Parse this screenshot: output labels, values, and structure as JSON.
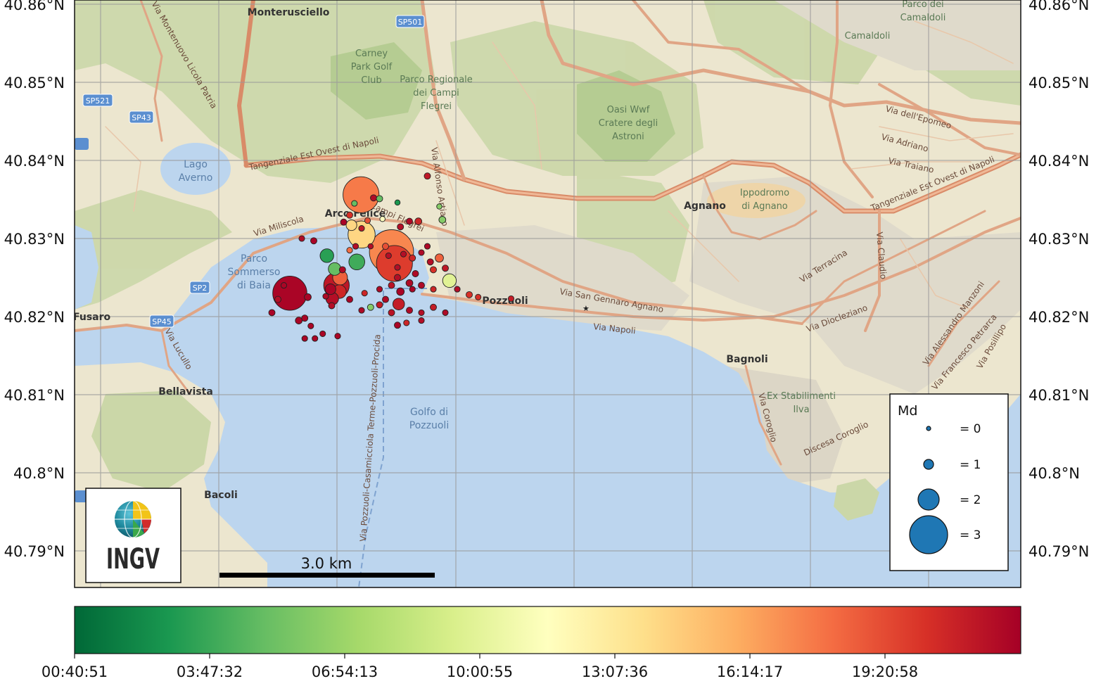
{
  "map": {
    "lat_labels": [
      "40.86°N",
      "40.85°N",
      "40.84°N",
      "40.83°N",
      "40.82°N",
      "40.81°N",
      "40.8°N",
      "40.79°N"
    ],
    "places": [
      {
        "id": "monterusciello",
        "text": "Monterusciello",
        "kind": "place"
      },
      {
        "id": "camaldoli",
        "text": "Camaldoli",
        "kind": "park"
      },
      {
        "id": "parco-camaldoli",
        "text": "Parco dei Camaldoli",
        "kind": "park"
      },
      {
        "id": "carney",
        "text": "Carney Park Golf Club",
        "kind": "park"
      },
      {
        "id": "parco-regionale",
        "text": "Parco Regionale dei Campi Flegrei",
        "kind": "park"
      },
      {
        "id": "oasi",
        "text": "Oasi Wwf Cratere degli Astroni",
        "kind": "park"
      },
      {
        "id": "lago-averno",
        "text": "Lago Averno",
        "kind": "water"
      },
      {
        "id": "arco-felice",
        "text": "Arco Felice",
        "kind": "place"
      },
      {
        "id": "agnano",
        "text": "Agnano",
        "kind": "place"
      },
      {
        "id": "ippodromo",
        "text": "Ippodromo di Agnano",
        "kind": "park"
      },
      {
        "id": "parco-sommerso",
        "text": "Parco Sommerso di Baia",
        "kind": "water"
      },
      {
        "id": "pozzuoli",
        "text": "Pozzuoli",
        "kind": "place"
      },
      {
        "id": "fusaro",
        "text": "Fusaro",
        "kind": "place"
      },
      {
        "id": "bagnoli",
        "text": "Bagnoli",
        "kind": "place"
      },
      {
        "id": "bellavista",
        "text": "Bellavista",
        "kind": "place"
      },
      {
        "id": "golfo",
        "text": "Golfo di Pozzuoli",
        "kind": "water"
      },
      {
        "id": "ilva",
        "text": "Ex Stabilimenti Ilva",
        "kind": "park"
      },
      {
        "id": "bacoli",
        "text": "Bacoli",
        "kind": "place"
      }
    ],
    "roads": [
      "Tangenziale Est Ovest di Napoli",
      "Via Campi Flegrei",
      "Via Miliscola",
      "Via Alfonso Artiaco",
      "Via San Gennaro Agnano",
      "Via Napoli",
      "Via dell'Epomeo",
      "Via Adriano",
      "Via Terracina",
      "Via Claudio",
      "Via Diocleziano",
      "Via Coroglio",
      "Discesa Coroglio",
      "Via Lucullo",
      "Via Montenuovo Licola Patria",
      "Via Pozzuoli-Casamicciola Terme-Pozzuoli-Procida",
      "Via Alessandro Manzoni",
      "Via Francesco Petrarca",
      "Via Posillipo",
      "Via Traiano"
    ],
    "shields": [
      "SP501",
      "SP521",
      "SP43",
      "SP2",
      "SP45"
    ],
    "colors": {
      "sea": "#bcd5ee",
      "land": "#ede8d4",
      "green": "#c9d7a9",
      "park": "#b9cf99",
      "urban": "#ded8c8",
      "road": "#e4a98a",
      "highway": "#d98b68",
      "grid": "#9a9a9a"
    }
  },
  "chart_data": {
    "type": "scatter",
    "y_axis": {
      "ticks": [
        "40.86°N",
        "40.85°N",
        "40.84°N",
        "40.83°N",
        "40.82°N",
        "40.81°N",
        "40.8°N",
        "40.79°N"
      ]
    },
    "size_legend": {
      "title": "Md",
      "entries": [
        {
          "label": "= 0",
          "md": 0
        },
        {
          "label": "= 1",
          "md": 1
        },
        {
          "label": "= 2",
          "md": 2
        },
        {
          "label": "= 3",
          "md": 3
        }
      ]
    },
    "colorbar": {
      "ticks": [
        "00:40:51",
        "03:47:32",
        "06:54:13",
        "10:00:55",
        "13:07:36",
        "16:14:17",
        "19:20:58"
      ],
      "colormap": "RdYlGn_r"
    },
    "scale_bar": {
      "label": "3.0 km"
    },
    "logo": {
      "text": "INGV"
    },
    "events": [
      {
        "lon": 14.118,
        "lat": 40.8305,
        "md": 2.4,
        "t": 0.62
      },
      {
        "lon": 14.1163,
        "lat": 40.8317,
        "md": 1.1,
        "t": 0.62
      },
      {
        "lon": 14.123,
        "lat": 40.8283,
        "md": 3.3,
        "t": 0.76
      },
      {
        "lon": 14.1235,
        "lat": 40.8268,
        "md": 2.9,
        "t": 0.88
      },
      {
        "lon": 14.1122,
        "lat": 40.8278,
        "md": 1.4,
        "t": 0.12
      },
      {
        "lon": 14.1135,
        "lat": 40.8261,
        "md": 1.3,
        "t": 0.2
      },
      {
        "lon": 14.1172,
        "lat": 40.827,
        "md": 1.6,
        "t": 0.15
      },
      {
        "lon": 14.1144,
        "lat": 40.825,
        "md": 1.5,
        "t": 0.82
      },
      {
        "lon": 14.1138,
        "lat": 40.824,
        "md": 2.3,
        "t": 0.95
      },
      {
        "lon": 14.1131,
        "lat": 40.8223,
        "md": 1.3,
        "t": 0.97
      },
      {
        "lon": 14.106,
        "lat": 40.823,
        "md": 2.8,
        "t": 0.99
      },
      {
        "lon": 14.1143,
        "lat": 40.8232,
        "md": 1.4,
        "t": 0.92
      },
      {
        "lon": 14.1327,
        "lat": 40.8246,
        "md": 1.4,
        "t": 0.42
      },
      {
        "lon": 14.1242,
        "lat": 40.8216,
        "md": 1.2,
        "t": 0.94
      },
      {
        "lon": 14.1128,
        "lat": 40.8235,
        "md": 1.1,
        "t": 0.99
      },
      {
        "lon": 14.1179,
        "lat": 40.8356,
        "md": 2.9,
        "t": 0.78
      },
      {
        "lon": 14.126,
        "lat": 40.8322,
        "md": 0.5,
        "t": 0.98
      },
      {
        "lon": 14.1275,
        "lat": 40.8322,
        "md": 0.6,
        "t": 0.92
      },
      {
        "lon": 14.129,
        "lat": 40.829,
        "md": 0.4,
        "t": 0.98
      },
      {
        "lon": 14.129,
        "lat": 40.838,
        "md": 0.5,
        "t": 0.95
      },
      {
        "lon": 14.12,
        "lat": 40.8352,
        "md": 0.5,
        "t": 0.98
      },
      {
        "lon": 14.121,
        "lat": 40.8351,
        "md": 0.5,
        "t": 0.2
      },
      {
        "lon": 14.124,
        "lat": 40.8346,
        "md": 0.3,
        "t": 0.1
      },
      {
        "lon": 14.131,
        "lat": 40.8341,
        "md": 0.3,
        "t": 0.25
      },
      {
        "lon": 14.1315,
        "lat": 40.8324,
        "md": 0.6,
        "t": 0.25
      },
      {
        "lon": 14.1168,
        "lat": 40.8345,
        "md": 0.4,
        "t": 0.2
      },
      {
        "lon": 14.116,
        "lat": 40.833,
        "md": 0.5,
        "t": 0.9
      },
      {
        "lon": 14.115,
        "lat": 40.8321,
        "md": 0.5,
        "t": 0.99
      },
      {
        "lon": 14.11,
        "lat": 40.8297,
        "md": 0.5,
        "t": 0.99
      },
      {
        "lon": 14.119,
        "lat": 40.8323,
        "md": 0.4,
        "t": 0.85
      },
      {
        "lon": 14.118,
        "lat": 40.8313,
        "md": 0.4,
        "t": 0.95
      },
      {
        "lon": 14.1215,
        "lat": 40.8325,
        "md": 0.3,
        "t": 0.5
      },
      {
        "lon": 14.1245,
        "lat": 40.8315,
        "md": 0.5,
        "t": 0.97
      },
      {
        "lon": 14.117,
        "lat": 40.829,
        "md": 0.4,
        "t": 0.97
      },
      {
        "lon": 14.116,
        "lat": 40.8285,
        "md": 0.4,
        "t": 0.8
      },
      {
        "lon": 14.1195,
        "lat": 40.829,
        "md": 0.3,
        "t": 0.97
      },
      {
        "lon": 14.122,
        "lat": 40.829,
        "md": 0.5,
        "t": 0.85
      },
      {
        "lon": 14.125,
        "lat": 40.828,
        "md": 0.4,
        "t": 0.97
      },
      {
        "lon": 14.1265,
        "lat": 40.8275,
        "md": 0.5,
        "t": 0.92
      },
      {
        "lon": 14.128,
        "lat": 40.8282,
        "md": 0.4,
        "t": 0.98
      },
      {
        "lon": 14.1295,
        "lat": 40.827,
        "md": 0.5,
        "t": 0.97
      },
      {
        "lon": 14.13,
        "lat": 40.826,
        "md": 0.5,
        "t": 0.9
      },
      {
        "lon": 14.131,
        "lat": 40.8275,
        "md": 0.8,
        "t": 0.82
      },
      {
        "lon": 14.132,
        "lat": 40.8262,
        "md": 0.5,
        "t": 0.95
      },
      {
        "lon": 14.127,
        "lat": 40.8255,
        "md": 0.5,
        "t": 0.98
      },
      {
        "lon": 14.126,
        "lat": 40.8243,
        "md": 0.6,
        "t": 0.98
      },
      {
        "lon": 14.124,
        "lat": 40.825,
        "md": 0.5,
        "t": 0.97
      },
      {
        "lon": 14.123,
        "lat": 40.824,
        "md": 0.5,
        "t": 0.96
      },
      {
        "lon": 14.1245,
        "lat": 40.8232,
        "md": 0.7,
        "t": 0.99
      },
      {
        "lon": 14.128,
        "lat": 40.824,
        "md": 0.5,
        "t": 0.98
      },
      {
        "lon": 14.13,
        "lat": 40.8235,
        "md": 0.4,
        "t": 0.92
      },
      {
        "lon": 14.134,
        "lat": 40.8235,
        "md": 0.4,
        "t": 0.97
      },
      {
        "lon": 14.136,
        "lat": 40.8228,
        "md": 0.5,
        "t": 0.9
      },
      {
        "lon": 14.122,
        "lat": 40.8222,
        "md": 0.5,
        "t": 0.98
      },
      {
        "lon": 14.121,
        "lat": 40.8215,
        "md": 0.5,
        "t": 0.94
      },
      {
        "lon": 14.1195,
        "lat": 40.8212,
        "md": 0.5,
        "t": 0.25
      },
      {
        "lon": 14.118,
        "lat": 40.8208,
        "md": 0.4,
        "t": 0.98
      },
      {
        "lon": 14.126,
        "lat": 40.8208,
        "md": 0.5,
        "t": 0.98
      },
      {
        "lon": 14.128,
        "lat": 40.8205,
        "md": 0.4,
        "t": 0.97
      },
      {
        "lon": 14.13,
        "lat": 40.8212,
        "md": 0.5,
        "t": 0.94
      },
      {
        "lon": 14.132,
        "lat": 40.8205,
        "md": 0.4,
        "t": 0.98
      },
      {
        "lon": 14.123,
        "lat": 40.8205,
        "md": 0.5,
        "t": 0.96
      },
      {
        "lon": 14.116,
        "lat": 40.8222,
        "md": 0.5,
        "t": 0.99
      },
      {
        "lon": 14.113,
        "lat": 40.8214,
        "md": 0.5,
        "t": 0.97
      },
      {
        "lon": 14.112,
        "lat": 40.8226,
        "md": 0.4,
        "t": 0.98
      },
      {
        "lon": 14.109,
        "lat": 40.8225,
        "md": 0.6,
        "t": 0.99
      },
      {
        "lon": 14.105,
        "lat": 40.824,
        "md": 0.4,
        "t": 0.99
      },
      {
        "lon": 14.104,
        "lat": 40.8222,
        "md": 0.5,
        "t": 0.97
      },
      {
        "lon": 14.103,
        "lat": 40.8205,
        "md": 0.5,
        "t": 0.99
      },
      {
        "lon": 14.1085,
        "lat": 40.8198,
        "md": 0.5,
        "t": 0.99
      },
      {
        "lon": 14.1075,
        "lat": 40.8195,
        "md": 0.6,
        "t": 0.99
      },
      {
        "lon": 14.1095,
        "lat": 40.8188,
        "md": 0.4,
        "t": 0.99
      },
      {
        "lon": 14.1115,
        "lat": 40.8178,
        "md": 0.4,
        "t": 0.99
      },
      {
        "lon": 14.1085,
        "lat": 40.8172,
        "md": 0.4,
        "t": 0.99
      },
      {
        "lon": 14.1102,
        "lat": 40.8172,
        "md": 0.4,
        "t": 0.99
      },
      {
        "lon": 14.114,
        "lat": 40.8175,
        "md": 0.4,
        "t": 0.99
      },
      {
        "lon": 14.124,
        "lat": 40.8189,
        "md": 0.5,
        "t": 0.99
      },
      {
        "lon": 14.1255,
        "lat": 40.8192,
        "md": 0.4,
        "t": 0.92
      },
      {
        "lon": 14.128,
        "lat": 40.8195,
        "md": 0.4,
        "t": 0.97
      },
      {
        "lon": 14.1375,
        "lat": 40.8225,
        "md": 0.4,
        "t": 0.9
      },
      {
        "lon": 14.143,
        "lat": 40.8223,
        "md": 0.4,
        "t": 0.94
      },
      {
        "lon": 14.108,
        "lat": 40.83,
        "md": 0.4,
        "t": 0.98
      },
      {
        "lon": 14.1265,
        "lat": 40.8235,
        "md": 0.4,
        "t": 0.99
      },
      {
        "lon": 14.1185,
        "lat": 40.823,
        "md": 0.4,
        "t": 0.92
      },
      {
        "lon": 14.121,
        "lat": 40.8235,
        "md": 0.4,
        "t": 0.98
      },
      {
        "lon": 14.124,
        "lat": 40.8263,
        "md": 0.4,
        "t": 0.97
      },
      {
        "lon": 14.1225,
        "lat": 40.8278,
        "md": 0.4,
        "t": 0.97
      },
      {
        "lon": 14.1148,
        "lat": 40.826,
        "md": 0.5,
        "t": 0.98
      }
    ]
  }
}
